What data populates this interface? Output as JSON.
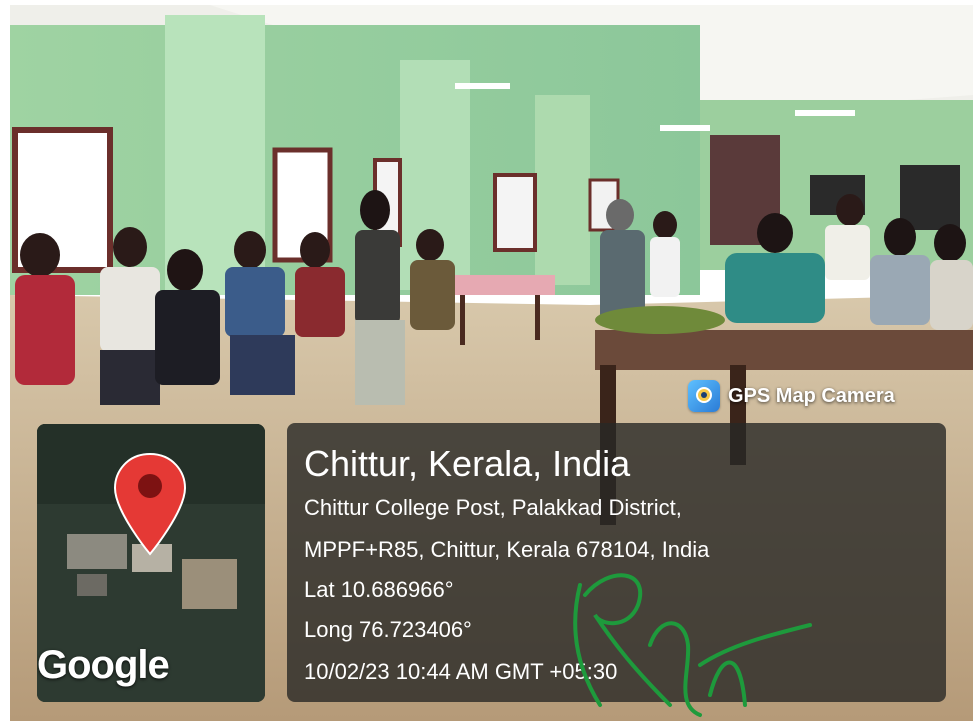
{
  "overlay": {
    "app_badge": "GPS Map Camera",
    "map_attribution": "Google",
    "city": "Chittur, Kerala, India",
    "address_line1": "Chittur College Post, Palakkad District,",
    "address_line2": "MPPF+R85, Chittur, Kerala 678104, India",
    "latitude": "Lat 10.686966°",
    "longitude": "Long 76.723406°",
    "timestamp": "10/02/23 10:44 AM GMT +05:30"
  },
  "colors": {
    "wall": "#a4d6a6",
    "floor": "#cdb99d",
    "pin": "#e53935",
    "signature": "#1e9a3c",
    "overlay_panel": "#2a2a28"
  }
}
